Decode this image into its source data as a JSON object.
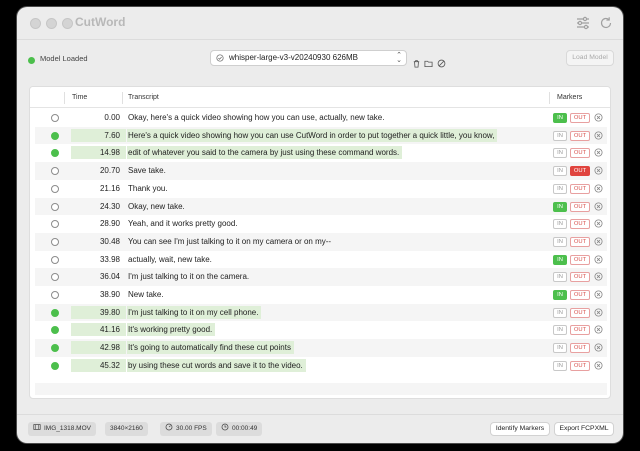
{
  "window": {
    "title": "CutWord"
  },
  "toolbar": {
    "status_text": "Model Loaded",
    "model_select_value": "whisper-large-v3-v20240930 626MB",
    "load_button_label": "Load Model"
  },
  "table": {
    "headers": {
      "time": "Time",
      "transcript": "Transcript",
      "markers": "Markers"
    },
    "in_label": "IN",
    "out_label": "OUT",
    "rows": [
      {
        "time": "0.00",
        "text": "Okay, here's a quick video showing how you can use, actually, new take.",
        "selected": false,
        "highlighted": false,
        "marker_in": true,
        "marker_out": false
      },
      {
        "time": "7.60",
        "text": "Here's a quick video showing how you can use CutWord in order to put together a quick little, you know,",
        "selected": true,
        "highlighted": true,
        "marker_in": false,
        "marker_out": false
      },
      {
        "time": "14.98",
        "text": "edit of whatever you said to the camera by just using these command words.",
        "selected": true,
        "highlighted": true,
        "marker_in": false,
        "marker_out": false
      },
      {
        "time": "20.70",
        "text": "Save take.",
        "selected": false,
        "highlighted": false,
        "marker_in": false,
        "marker_out": true
      },
      {
        "time": "21.16",
        "text": "Thank you.",
        "selected": false,
        "highlighted": false,
        "marker_in": false,
        "marker_out": false
      },
      {
        "time": "24.30",
        "text": "Okay, new take.",
        "selected": false,
        "highlighted": false,
        "marker_in": true,
        "marker_out": false
      },
      {
        "time": "28.90",
        "text": "Yeah, and it works pretty good.",
        "selected": false,
        "highlighted": false,
        "marker_in": false,
        "marker_out": false
      },
      {
        "time": "30.48",
        "text": "You can see I'm just talking to it on my camera or on my--",
        "selected": false,
        "highlighted": false,
        "marker_in": false,
        "marker_out": false
      },
      {
        "time": "33.98",
        "text": "actually, wait, new take.",
        "selected": false,
        "highlighted": false,
        "marker_in": true,
        "marker_out": false
      },
      {
        "time": "36.04",
        "text": "I'm just talking to it on the camera.",
        "selected": false,
        "highlighted": false,
        "marker_in": false,
        "marker_out": false
      },
      {
        "time": "38.90",
        "text": "New take.",
        "selected": false,
        "highlighted": false,
        "marker_in": true,
        "marker_out": false
      },
      {
        "time": "39.80",
        "text": "I'm just talking to it on my cell phone.",
        "selected": true,
        "highlighted": true,
        "marker_in": false,
        "marker_out": false
      },
      {
        "time": "41.16",
        "text": "It's working pretty good.",
        "selected": true,
        "highlighted": true,
        "marker_in": false,
        "marker_out": false
      },
      {
        "time": "42.98",
        "text": "It's going to automatically find these cut points",
        "selected": true,
        "highlighted": true,
        "marker_in": false,
        "marker_out": false
      },
      {
        "time": "45.32",
        "text": "by using these cut words and save it to the video.",
        "selected": true,
        "highlighted": true,
        "marker_in": false,
        "marker_out": false
      }
    ]
  },
  "footer": {
    "filename": "IMG_1318.MOV",
    "resolution": "3840×2160",
    "fps": "30.00 FPS",
    "duration": "00:00:49",
    "identify_button_label": "Identify Markers",
    "export_button_label": "Export FCPXML"
  },
  "colors": {
    "accent_green": "#4cbf4c",
    "out_red": "#e0443e",
    "highlight": "#dfefd8"
  }
}
